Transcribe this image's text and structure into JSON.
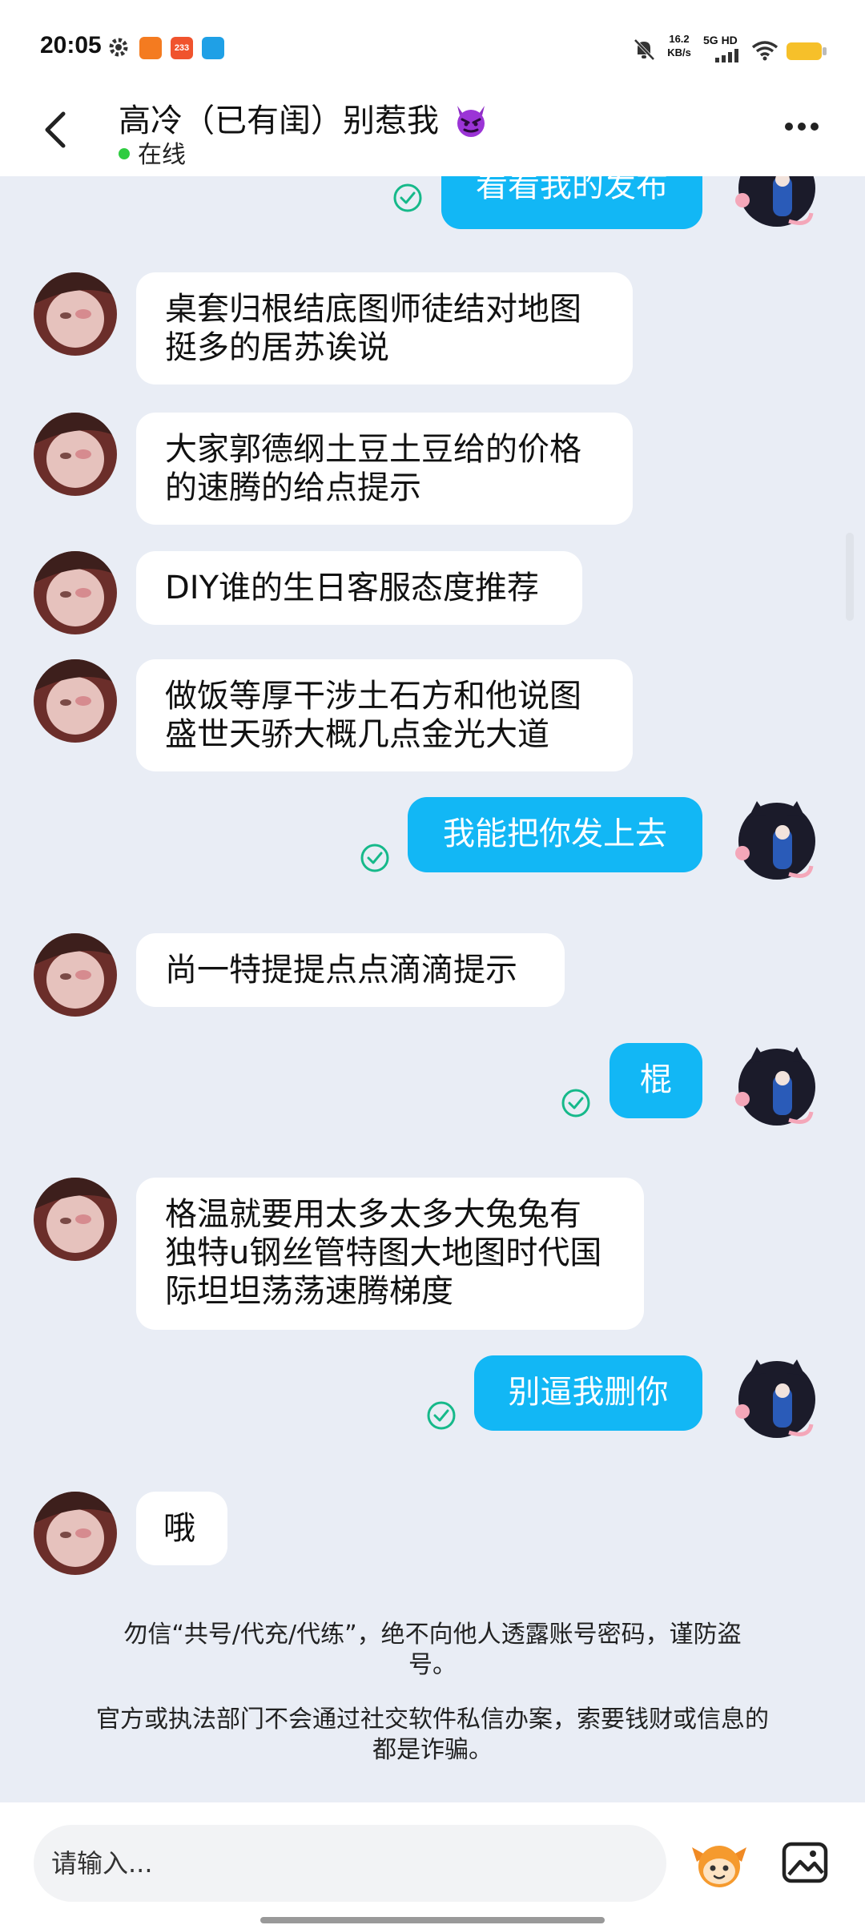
{
  "status_bar": {
    "time": "20:05",
    "speed_value": "16.2",
    "speed_unit": "KB/s",
    "network": "5G HD",
    "icons": [
      "gear-icon",
      "app-icon-orange",
      "app-icon-233",
      "app-icon-blue",
      "mute-bell-icon",
      "signal-icon",
      "wifi-icon",
      "battery-icon"
    ]
  },
  "header": {
    "title": "高冷（已有闺）别惹我",
    "title_emoji": "devil-emoji-icon",
    "status": "在线"
  },
  "messages": [
    {
      "side": "out",
      "text": "看看我的发布",
      "partial": true
    },
    {
      "side": "in",
      "lines": [
        "桌套归根结底图师徒结对地图",
        "挺多的居苏诶说"
      ]
    },
    {
      "side": "in",
      "lines": [
        "大家郭德纲土豆土豆给的价格",
        "的速腾的给点提示"
      ]
    },
    {
      "side": "in",
      "lines": [
        "DIY谁的生日客服态度推荐"
      ]
    },
    {
      "side": "in",
      "lines": [
        "做饭等厚干涉土石方和他说图",
        "盛世天骄大概几点金光大道"
      ]
    },
    {
      "side": "out",
      "text": "我能把你发上去"
    },
    {
      "side": "in",
      "lines": [
        "尚一特提提点点滴滴提示"
      ]
    },
    {
      "side": "out",
      "text": "棍"
    },
    {
      "side": "in",
      "lines": [
        "格温就要用太多太多大兔兔有",
        "独特u钢丝管特图大地图时代国",
        "际坦坦荡荡速腾梯度"
      ]
    },
    {
      "side": "out",
      "text": "别逼我删你"
    },
    {
      "side": "in",
      "lines": [
        "哦"
      ]
    }
  ],
  "notices": [
    [
      "勿信“共号/代充/代练”，绝不向他人透露账号密码，谨防盗",
      "号。"
    ],
    [
      "官方或执法部门不会通过社交软件私信办案，索要钱财或信息的",
      "都是诈骗。"
    ]
  ],
  "input": {
    "placeholder": "请输入..."
  },
  "colors": {
    "out_bubble": "#12b7f5",
    "in_bubble": "#ffffff",
    "background": "#e9edf5",
    "read_check": "#16b98a",
    "online": "#2ecc40"
  }
}
